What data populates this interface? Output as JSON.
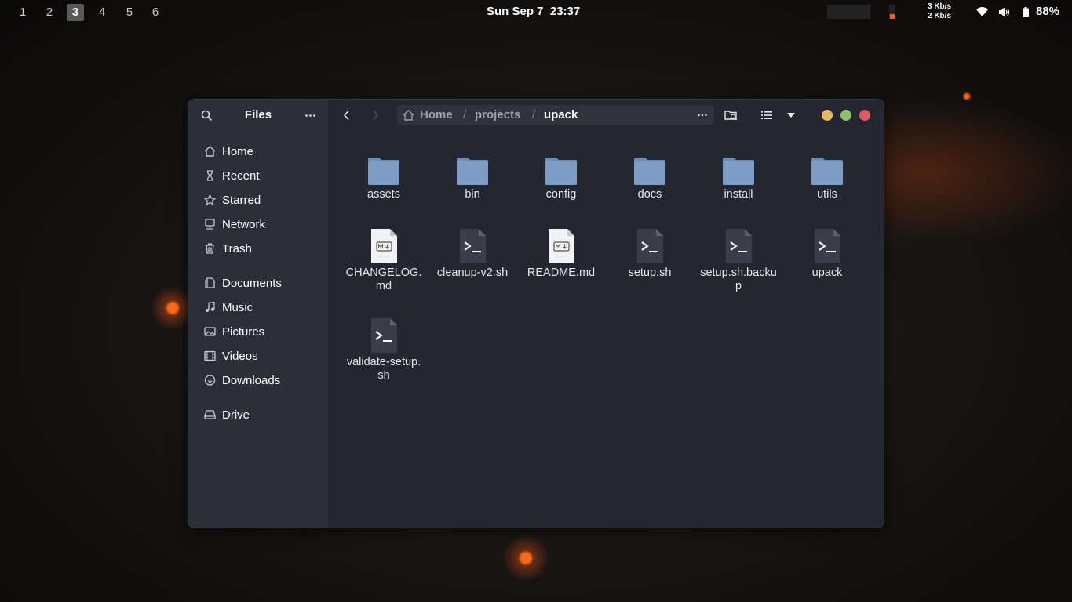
{
  "topbar": {
    "workspaces": [
      "1",
      "2",
      "3",
      "4",
      "5",
      "6"
    ],
    "active_workspace": "3",
    "clock": "Sun Sep 7  23:37",
    "net_up": "3 Kb/s",
    "net_down": "2 Kb/s",
    "battery": "88%",
    "icons": [
      "wifi-icon",
      "volume-icon",
      "battery-icon"
    ]
  },
  "window": {
    "sidebar": {
      "title": "Files",
      "places": [
        {
          "label": "Home",
          "icon": "home-icon"
        },
        {
          "label": "Recent",
          "icon": "clock-icon"
        },
        {
          "label": "Starred",
          "icon": "star-icon"
        },
        {
          "label": "Network",
          "icon": "network-icon"
        },
        {
          "label": "Trash",
          "icon": "trash-icon"
        }
      ],
      "bookmarks": [
        {
          "label": "Documents",
          "icon": "documents-icon"
        },
        {
          "label": "Music",
          "icon": "music-icon"
        },
        {
          "label": "Pictures",
          "icon": "pictures-icon"
        },
        {
          "label": "Videos",
          "icon": "videos-icon"
        },
        {
          "label": "Downloads",
          "icon": "downloads-icon"
        }
      ],
      "devices": [
        {
          "label": "Drive",
          "icon": "drive-icon"
        }
      ]
    },
    "pathbar": {
      "crumbs": [
        "Home",
        "projects",
        "upack"
      ],
      "separator": "/"
    },
    "colors": {
      "minimize": "#e5b85c",
      "maximize": "#8fbf6b",
      "close": "#e0595f",
      "folder": "#7d9cc6"
    },
    "files": [
      {
        "name": "assets",
        "type": "folder"
      },
      {
        "name": "bin",
        "type": "folder"
      },
      {
        "name": "config",
        "type": "folder"
      },
      {
        "name": "docs",
        "type": "folder"
      },
      {
        "name": "install",
        "type": "folder"
      },
      {
        "name": "utils",
        "type": "folder"
      },
      {
        "name": "CHANGELOG.md",
        "type": "markdown"
      },
      {
        "name": "cleanup-v2.sh",
        "type": "script"
      },
      {
        "name": "README.md",
        "type": "markdown"
      },
      {
        "name": "setup.sh",
        "type": "script"
      },
      {
        "name": "setup.sh.backup",
        "type": "script"
      },
      {
        "name": "upack",
        "type": "script"
      },
      {
        "name": "validate-setup.sh",
        "type": "script"
      }
    ]
  }
}
